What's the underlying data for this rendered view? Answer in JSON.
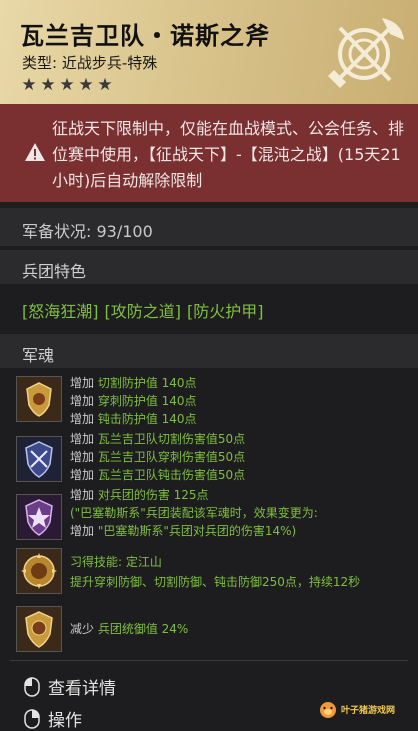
{
  "header": {
    "title": "瓦兰吉卫队・诺斯之斧",
    "type": "类型: 近战步兵-特殊",
    "stars": [
      "★",
      "★",
      "★",
      "★",
      "★"
    ],
    "accent": "#d9c48c"
  },
  "warning": {
    "text": "征战天下限制中，仅能在血战模式、公会任务、排位赛中使用，【征战天下】-【混沌之战】(15天21小时)后自动解除限制",
    "icon": "warning-triangle-icon"
  },
  "status": {
    "readiness": "军备状况: 93/100"
  },
  "sections": {
    "traits_title": "兵团特色",
    "soul_title": "军魂"
  },
  "traits": [
    "[怒海狂潮]",
    "[攻防之道]",
    "[防火护甲]"
  ],
  "souls": [
    {
      "icon": "gold-shield-soul-icon",
      "lines": [
        {
          "prefix": "增加 ",
          "text": "切割防护值 140点"
        },
        {
          "prefix": "增加 ",
          "text": "穿刺防护值 140点"
        },
        {
          "prefix": "增加 ",
          "text": "钝击防护值 140点"
        }
      ]
    },
    {
      "icon": "blue-shield-soul-icon",
      "lines": [
        {
          "prefix": "增加 ",
          "text": "瓦兰吉卫队切割伤害值50点"
        },
        {
          "prefix": "增加 ",
          "text": "瓦兰吉卫队穿刺伤害值50点"
        },
        {
          "prefix": "增加 ",
          "text": "瓦兰吉卫队钝击伤害值50点"
        }
      ]
    },
    {
      "icon": "purple-shield-soul-icon",
      "lines": [
        {
          "prefix": "增加 ",
          "text": "对兵团的伤害 125点"
        },
        {
          "prefix": "",
          "text": "(\"巴塞勒斯系\"兵团装配该军魂时，效果变更为:"
        },
        {
          "prefix": "增加 ",
          "text": "\"巴塞勒斯系\"兵团对兵团的伤害14%)"
        }
      ]
    },
    {
      "icon": "gold-round-soul-icon",
      "lines": [
        {
          "prefix": "",
          "text": "习得技能: 定江山"
        },
        {
          "prefix": "",
          "text": "提升穿刺防御、切割防御、钝击防御250点，持续12秒"
        }
      ]
    },
    {
      "icon": "gold-emblem-soul-icon",
      "lines": [
        {
          "prefix": "减少 ",
          "text": "兵团统御值 24%"
        }
      ]
    }
  ],
  "actions": {
    "details": "查看详情",
    "operate": "操作"
  },
  "watermark": {
    "text": "叶子猪游戏网"
  }
}
